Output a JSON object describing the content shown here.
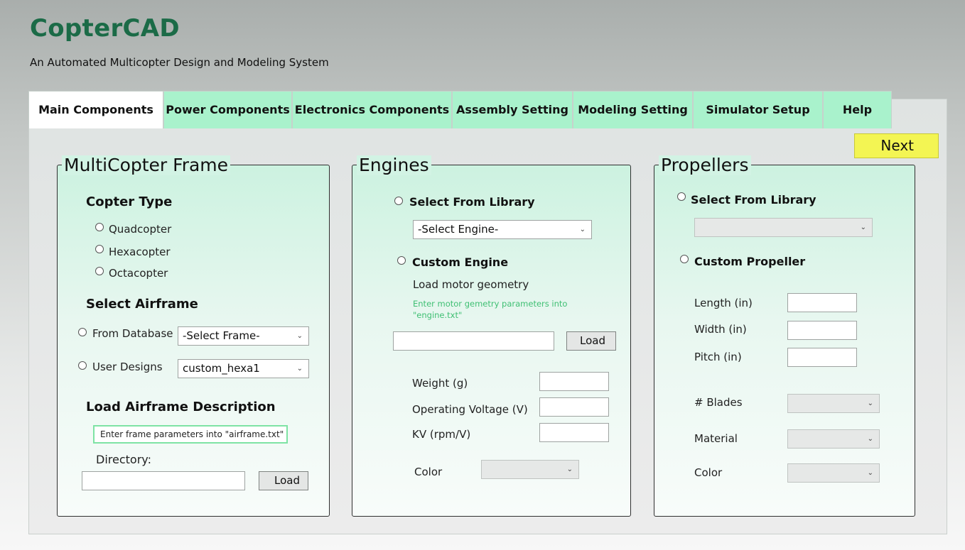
{
  "app": {
    "title": "CopterCAD",
    "subtitle": "An Automated Multicopter Design and Modeling System"
  },
  "tabs": [
    {
      "label": "Main Components",
      "active": true
    },
    {
      "label": "Power Components"
    },
    {
      "label": "Electronics Components"
    },
    {
      "label": "Assembly Setting"
    },
    {
      "label": "Modeling Setting"
    },
    {
      "label": "Simulator Setup"
    },
    {
      "label": "Help"
    }
  ],
  "next_label": "Next",
  "frame": {
    "title": "MultiCopter Frame",
    "copter_type_heading": "Copter Type",
    "copter_types": [
      "Quadcopter",
      "Hexacopter",
      "Octacopter"
    ],
    "select_airframe_heading": "Select Airframe",
    "from_database_label": "From Database",
    "from_database_value": "-Select Frame-",
    "user_designs_label": "User Designs",
    "user_designs_value": "custom_hexa1",
    "load_desc_heading": "Load Airframe Description",
    "hint": "Enter frame parameters into \"airframe.txt\"",
    "directory_label": "Directory:",
    "directory_value": "",
    "load_label": "Load"
  },
  "engines": {
    "title": "Engines",
    "select_library_label": "Select From Library",
    "engine_select_value": "-Select Engine-",
    "custom_engine_label": "Custom Engine",
    "load_geometry_label": "Load motor geometry",
    "hint_line1": "Enter motor gemetry parameters into",
    "hint_line2": "\"engine.txt\"",
    "path_value": "",
    "load_label": "Load",
    "weight_label": "Weight (g)",
    "voltage_label": "Operating Voltage (V)",
    "kv_label": "KV (rpm/V)",
    "color_label": "Color",
    "weight_value": "",
    "voltage_value": "",
    "kv_value": "",
    "color_value": ""
  },
  "propellers": {
    "title": "Propellers",
    "select_library_label": "Select From Library",
    "library_value": "",
    "custom_label": "Custom Propeller",
    "length_label": "Length (in)",
    "width_label": "Width (in)",
    "pitch_label": "Pitch (in)",
    "blades_label": "# Blades",
    "material_label": "Material",
    "color_label": "Color",
    "length_value": "",
    "width_value": "",
    "pitch_value": "",
    "blades_value": "",
    "material_value": "",
    "color_value": ""
  }
}
